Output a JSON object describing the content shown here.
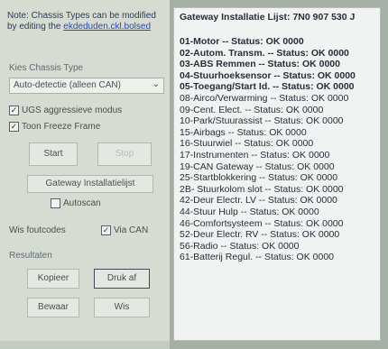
{
  "note": {
    "text": "Note: Chassis Types can be modified by editing the",
    "link": "ekdeduden.ckl.bolsed"
  },
  "chassis": {
    "label": "Kies Chassis Type",
    "selected": "Auto-detectie (alleen CAN)"
  },
  "options": {
    "ugs": "UGS aggressieve modus",
    "freeze": "Toon Freeze Frame"
  },
  "buttons": {
    "start": "Start",
    "stop": "Stop",
    "gateway": "Gateway Installatielijst",
    "autoscan": "Autoscan",
    "clear": "Wis foutcodes",
    "via_can": "Via CAN",
    "copy": "Kopieer",
    "print": "Druk af",
    "browse": "Bewaar",
    "erase": "Wis"
  },
  "results_label": "Resultaten",
  "list": {
    "header": "Gateway Installatie Lijst:  7N0 907 530 J",
    "rows": [
      {
        "text": "01-Motor -- Status: OK 0000",
        "bold": true
      },
      {
        "text": "02-Autom. Transm. -- Status: OK 0000",
        "bold": true
      },
      {
        "text": "03-ABS Remmen -- Status: OK 0000",
        "bold": true
      },
      {
        "text": "04-Stuurhoeksensor -- Status: OK 0000",
        "bold": true
      },
      {
        "text": "05-Toegang/Start Id. -- Status: OK 0000",
        "bold": true
      },
      {
        "text": "08-Airco/Verwarming -- Status: OK 0000",
        "bold": false
      },
      {
        "text": "09-Cent. Elect. -- Status: OK 0000",
        "bold": false
      },
      {
        "text": "10-Park/Stuurassist -- Status: OK 0000",
        "bold": false
      },
      {
        "text": "15-Airbags -- Status: OK 0000",
        "bold": false
      },
      {
        "text": "16-Stuurwiel -- Status: OK 0000",
        "bold": false
      },
      {
        "text": "17-Instrumenten -- Status: OK 0000",
        "bold": false
      },
      {
        "text": "19-CAN Gateway -- Status: OK 0000",
        "bold": false
      },
      {
        "text": "25-Startblokkering -- Status: OK 0000",
        "bold": false
      },
      {
        "text": "2B- Stuurkolom slot -- Status: OK 0000",
        "bold": false
      },
      {
        "text": "42-Deur Electr. LV -- Status: OK 0000",
        "bold": false
      },
      {
        "text": "44-Stuur Hulp -- Status: OK 0000",
        "bold": false
      },
      {
        "text": "46-Comfortsysteem -- Status: OK 0000",
        "bold": false
      },
      {
        "text": "52-Deur Electr. RV -- Status: OK 0000",
        "bold": false
      },
      {
        "text": "56-Radio -- Status: OK 0000",
        "bold": false
      },
      {
        "text": "61-Batterij Regul. -- Status: OK 0000",
        "bold": false
      }
    ]
  }
}
